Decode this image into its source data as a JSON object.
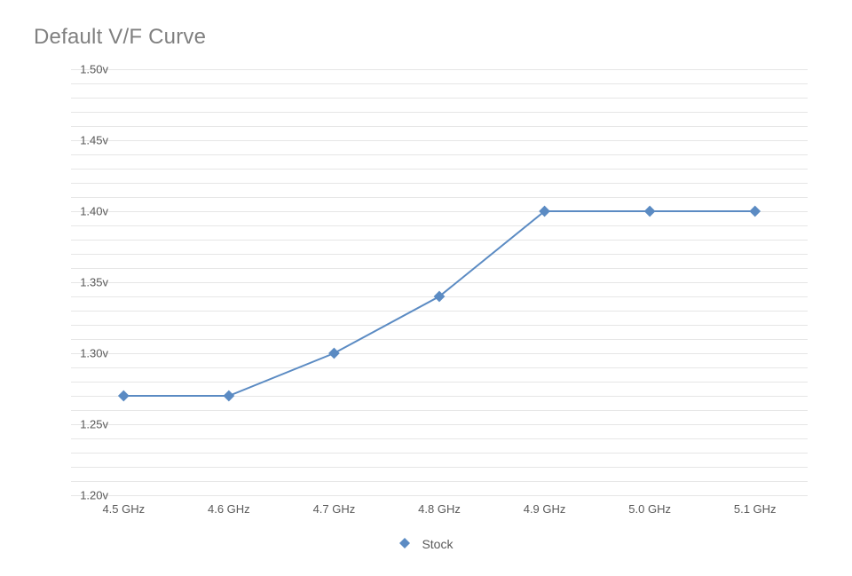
{
  "title": "Default V/F Curve",
  "chart_data": {
    "type": "line",
    "title": "Default V/F Curve",
    "xlabel": "",
    "ylabel": "",
    "categories": [
      "4.5 GHz",
      "4.6 GHz",
      "4.7 GHz",
      "4.8 GHz",
      "4.9 GHz",
      "5.0 GHz",
      "5.1 GHz"
    ],
    "series": [
      {
        "name": "Stock",
        "values": [
          1.27,
          1.27,
          1.3,
          1.34,
          1.4,
          1.4,
          1.4
        ]
      }
    ],
    "y_ticks": [
      "1.20v",
      "1.25v",
      "1.30v",
      "1.35v",
      "1.40v",
      "1.45v",
      "1.50v"
    ],
    "ylim": [
      1.2,
      1.5
    ],
    "grid": true,
    "legend_position": "bottom",
    "colors": {
      "series_stock": "#5b8bc3",
      "grid": "#e6e6e6",
      "text": "#595959",
      "title": "#808080"
    }
  },
  "legend": {
    "stock": "Stock"
  }
}
